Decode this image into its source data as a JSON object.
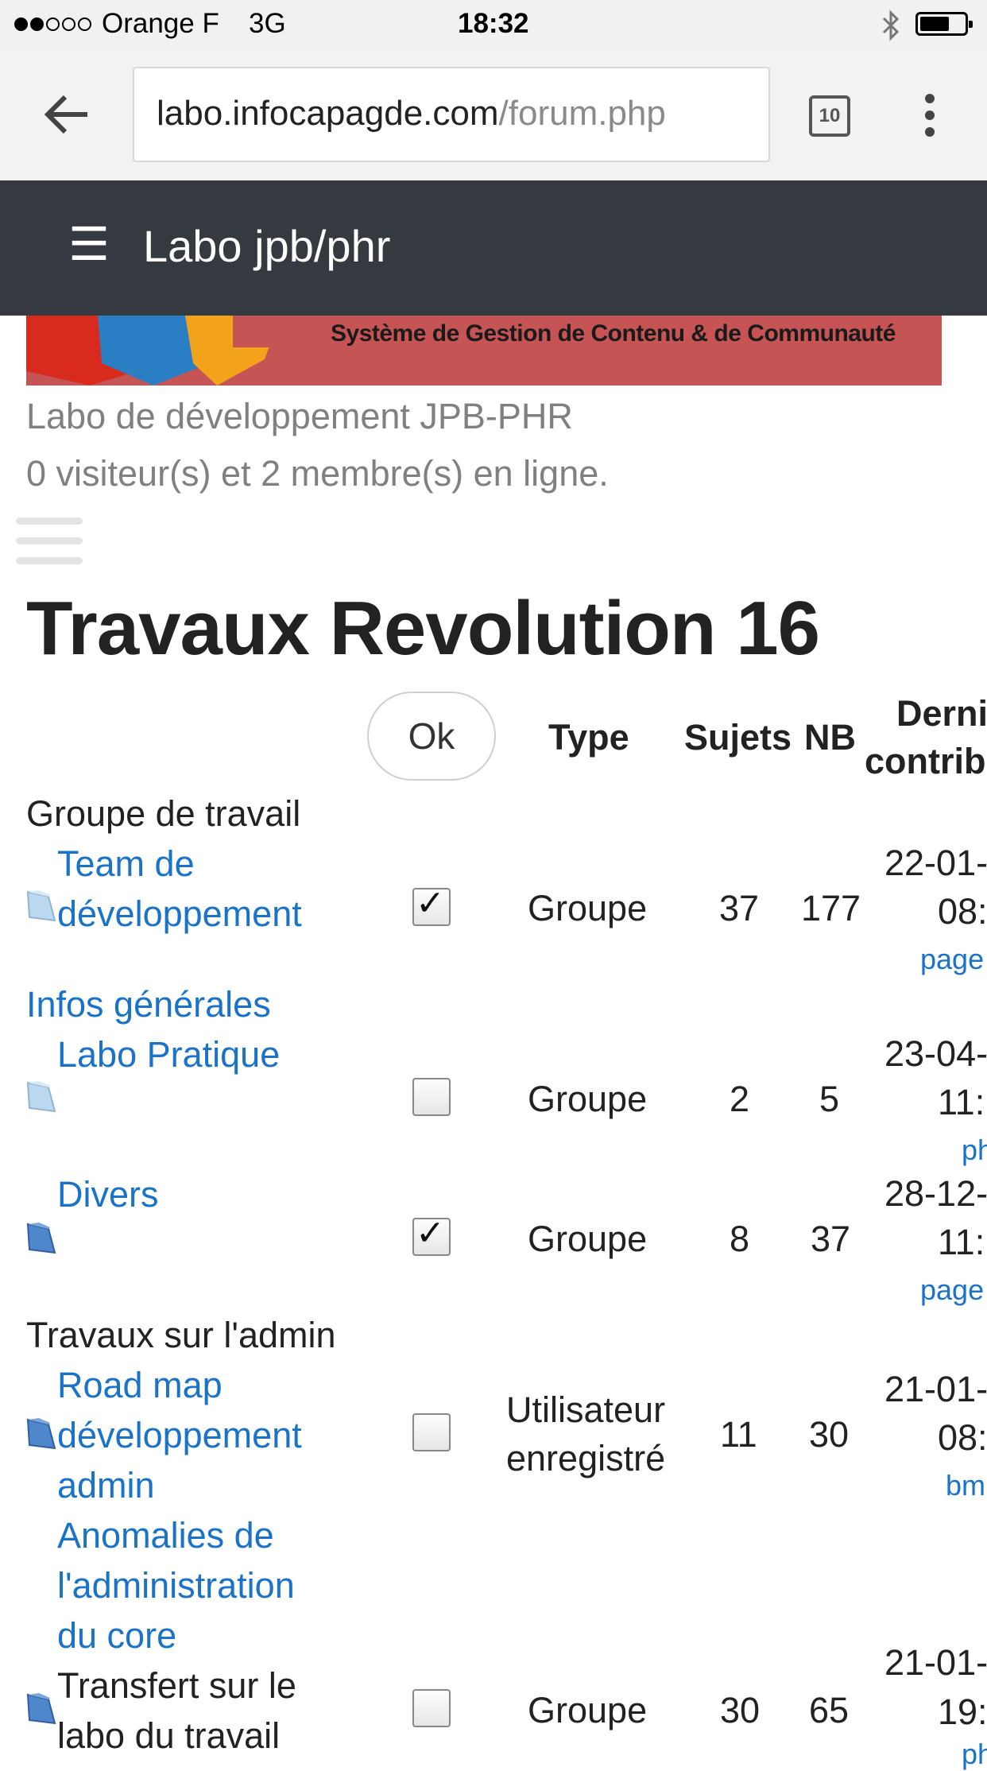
{
  "status_bar": {
    "carrier": "Orange F",
    "network": "3G",
    "time": "18:32"
  },
  "browser": {
    "url_host": "labo.infocapagde.com",
    "url_path": "/forum.php",
    "tab_count": "10"
  },
  "site": {
    "nav_title": "Labo jpb/phr",
    "banner_text": "Système de Gestion de Contenu & de Communauté",
    "subtitle": "Labo de développement JPB-PHR",
    "online": "0 visiteur(s) et 2 membre(s) en ligne."
  },
  "forum": {
    "title": "Travaux Revolution 16",
    "ok_button": "Ok",
    "headers": {
      "type": "Type",
      "sujets": "Sujets",
      "nb": "NB",
      "last_1": "Derni",
      "last_2": "contrib"
    },
    "categories": [
      "Groupe de travail",
      "Infos générales",
      "Travaux sur l'admin"
    ],
    "rows": [
      {
        "title_1": "Team de",
        "title_2": "développement",
        "checked": true,
        "type": "Groupe",
        "sujets": "37",
        "nb": "177",
        "date_1": "22-01-",
        "date_2": "08:",
        "last": "page"
      },
      {
        "title_1": "Labo Pratique",
        "checked": false,
        "type": "Groupe",
        "sujets": "2",
        "nb": "5",
        "date_1": "23-04-",
        "date_2": "11:",
        "last": "ph"
      },
      {
        "title_1": "Divers",
        "checked": true,
        "type": "Groupe",
        "sujets": "8",
        "nb": "37",
        "date_1": "28-12-",
        "date_2": "11:",
        "last": "page"
      },
      {
        "title_1": "Road map",
        "title_2": "développement",
        "title_3": "admin",
        "checked": false,
        "type_1": "Utilisateur",
        "type_2": "enregistré",
        "sujets": "11",
        "nb": "30",
        "date_1": "21-01-",
        "date_2": "08:",
        "last": "bm"
      },
      {
        "title_1": "Anomalies de",
        "title_2": "l'administration",
        "title_3": "du core"
      },
      {
        "title_1": "Transfert sur le",
        "title_2": "labo du travail",
        "checked": false,
        "type": "Groupe",
        "sujets": "30",
        "nb": "65",
        "date_1": "21-01-",
        "date_2": "19:",
        "last": "ph"
      }
    ]
  },
  "colors": {
    "link": "#1a73c8",
    "navbar": "#343a40",
    "banner": "#c65455",
    "folder_light": "#bcd8ef",
    "folder_dark": "#4f86cc"
  },
  "icons": [
    "back-arrow-icon",
    "tab-switcher-icon",
    "overflow-menu-icon",
    "hamburger-icon",
    "folder-icon",
    "checkbox",
    "bluetooth-icon",
    "battery-icon"
  ]
}
